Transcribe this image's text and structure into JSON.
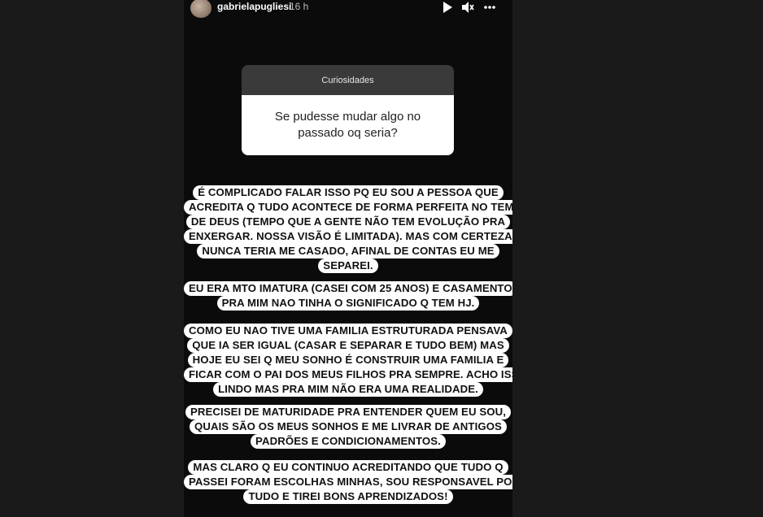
{
  "header": {
    "username": "gabrielapugliesi",
    "time": "16 h",
    "icons": [
      "avatar",
      "play-icon",
      "mute-icon",
      "more-icon"
    ]
  },
  "question": {
    "title": "Curiosidades",
    "text_line1": "Se pudesse mudar algo no",
    "text_line2": "passado oq seria?"
  },
  "answer_blocks": [
    [
      "É COMPLICADO FALAR ISSO PQ EU SOU A PESSOA QUE",
      "ACREDITA Q TUDO ACONTECE DE FORMA PERFEITA NO TEMPO",
      "DE DEUS (TEMPO QUE A GENTE NÃO TEM EVOLUÇÃO PRA",
      "ENXERGAR. NOSSA VISÃO É LIMITADA). MAS COM CERTEZA EU",
      "NUNCA TERIA ME CASADO, AFINAL DE CONTAS EU ME",
      "SEPAREI."
    ],
    [
      "EU ERA MTO IMATURA (CASEI COM 25 ANOS) E CASAMENTO",
      "PRA MIM NAO TINHA O SIGNIFICADO Q TEM HJ."
    ],
    [
      "COMO EU NAO TIVE UMA FAMILIA ESTRUTURADA PENSAVA",
      "QUE IA SER IGUAL (CASAR E SEPARAR E TUDO BEM) MAS",
      "HOJE EU SEI Q MEU SONHO É CONSTRUIR UMA FAMILIA E",
      "FICAR COM O PAI DOS MEUS FILHOS PRA SEMPRE. ACHO ISSO",
      "LINDO MAS PRA MIM NÃO ERA UMA REALIDADE."
    ],
    [
      "PRECISEI DE MATURIDADE PRA ENTENDER QUEM EU SOU,",
      "QUAIS SÃO OS MEUS SONHOS E ME LIVRAR DE ANTIGOS",
      "PADRÕES E CONDICIONAMENTOS."
    ],
    [
      "MAS CLARO Q EU CONTINUO ACREDITANDO QUE TUDO Q",
      "PASSEI FORAM ESCOLHAS MINHAS, SOU RESPONSAVEL POR",
      "TUDO E TIREI BONS APRENDIZADOS!"
    ]
  ]
}
